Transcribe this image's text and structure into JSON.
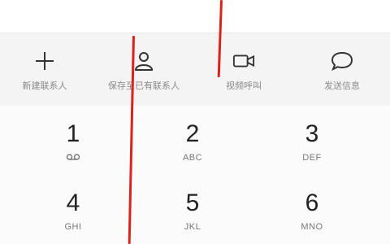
{
  "actions": [
    {
      "label": "新建联系人",
      "icon": "plus-icon"
    },
    {
      "label": "保存至已有联系人",
      "icon": "person-icon"
    },
    {
      "label": "视频呼叫",
      "icon": "video-camera-icon"
    },
    {
      "label": "发送信息",
      "icon": "message-bubble-icon"
    }
  ],
  "keys": [
    {
      "digit": "1",
      "letters": ""
    },
    {
      "digit": "2",
      "letters": "ABC"
    },
    {
      "digit": "3",
      "letters": "DEF"
    },
    {
      "digit": "4",
      "letters": "GHI"
    },
    {
      "digit": "5",
      "letters": "JKL"
    },
    {
      "digit": "6",
      "letters": "MNO"
    }
  ],
  "colors": {
    "annotation_red": "#d9231b",
    "text_gray": "#8a8a8a"
  }
}
